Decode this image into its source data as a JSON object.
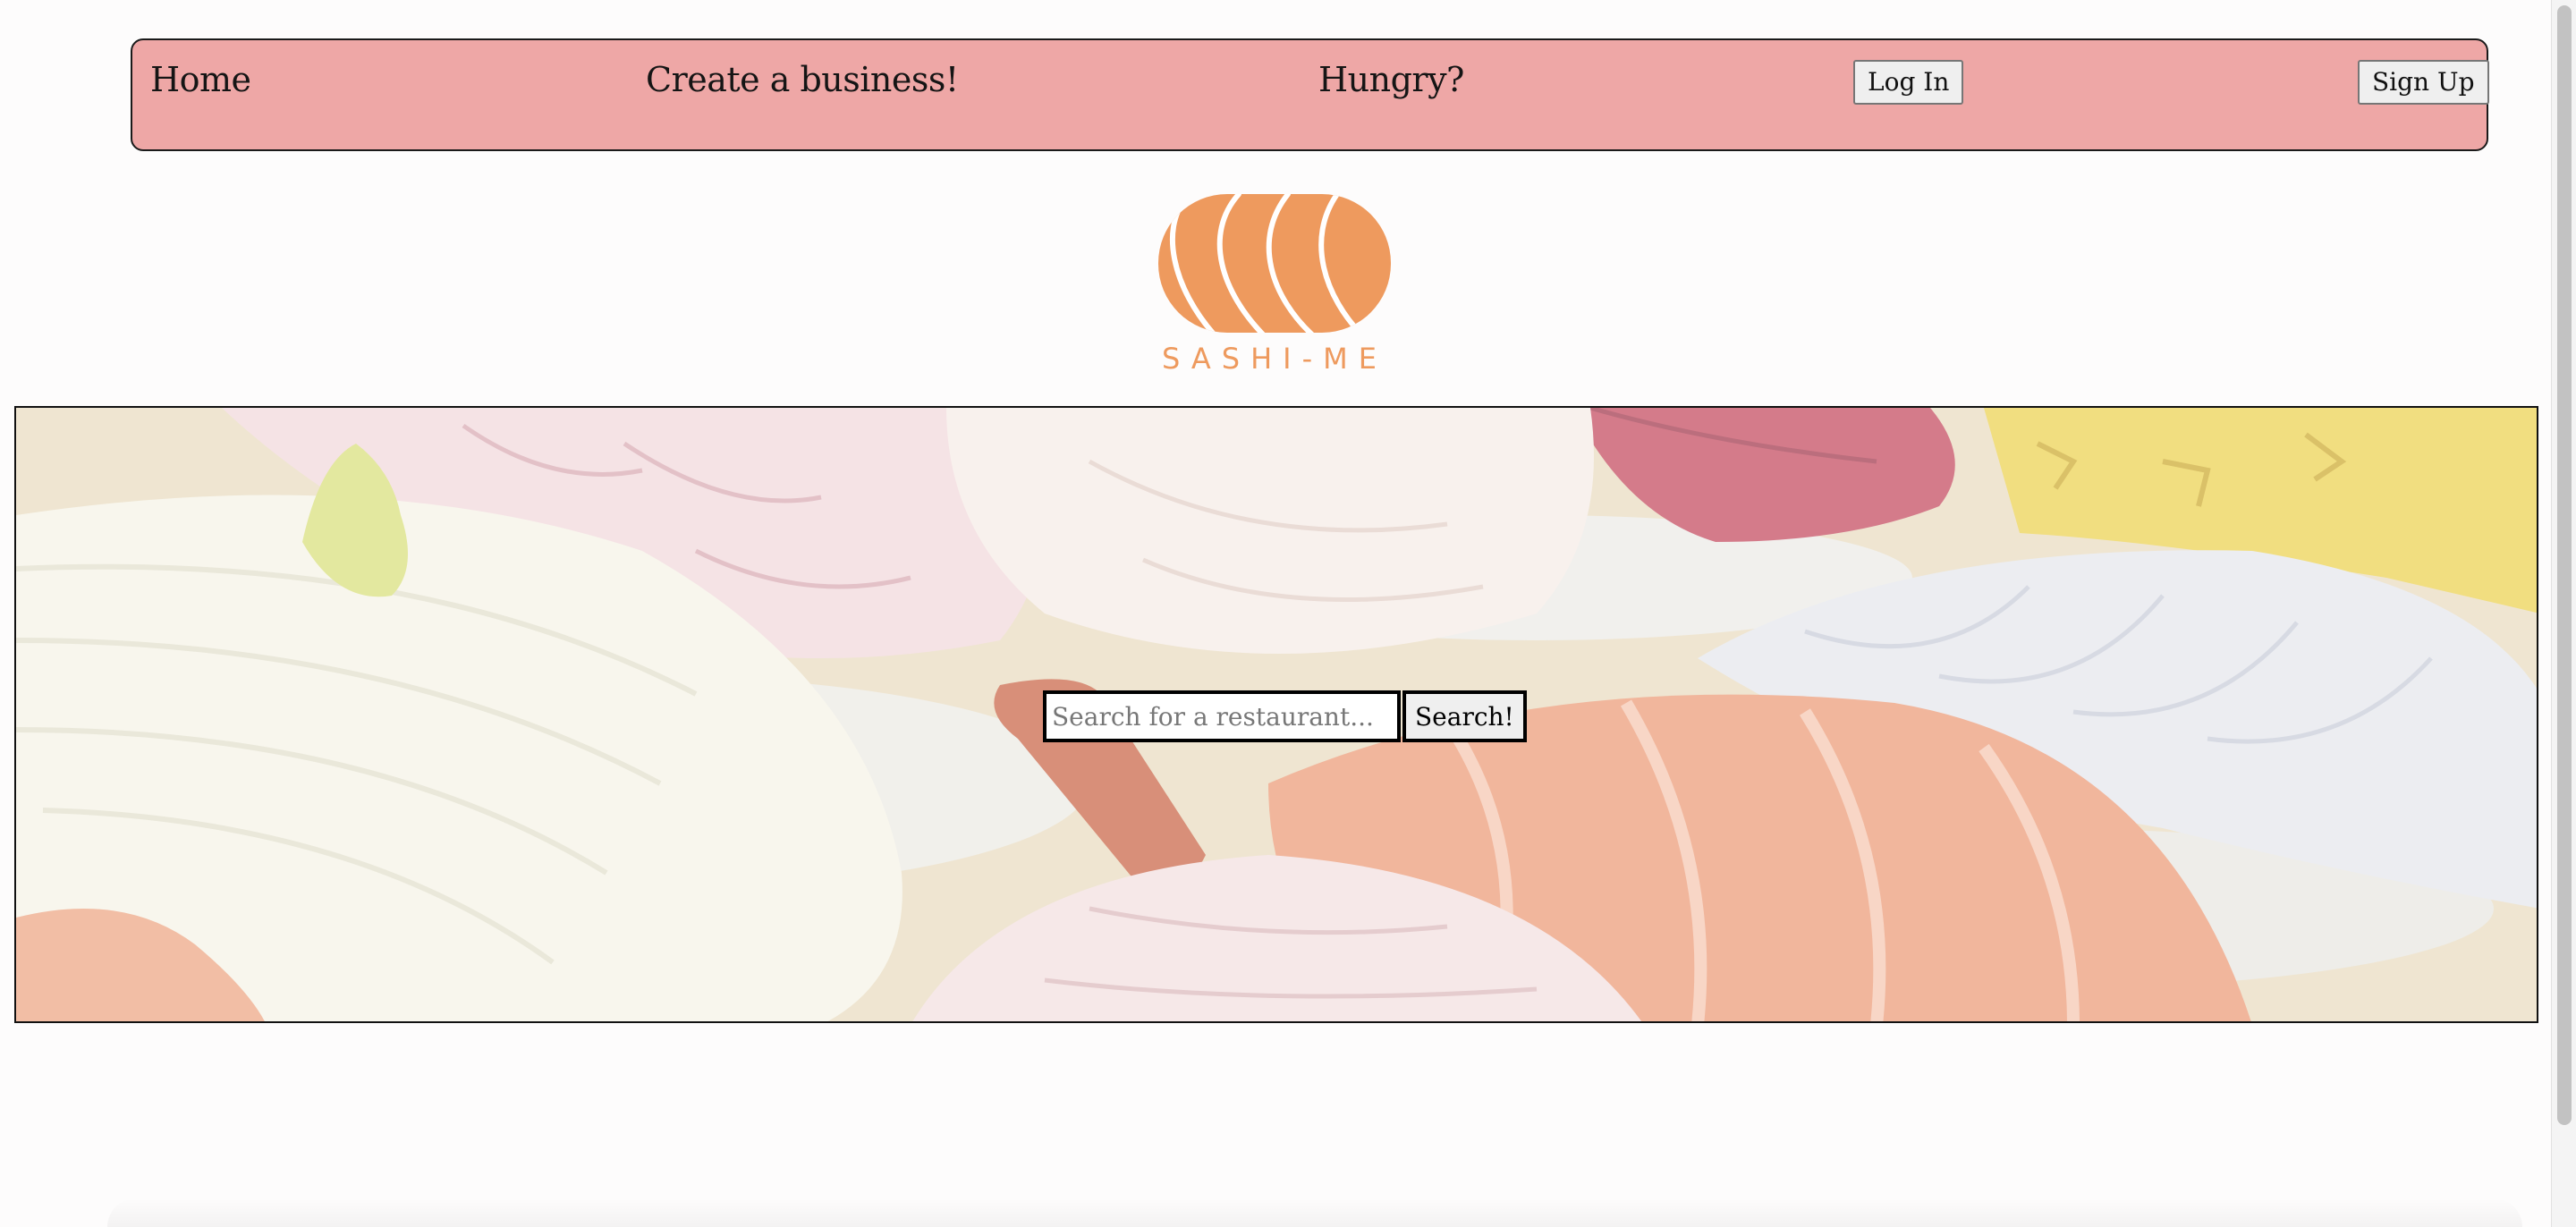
{
  "nav": {
    "home": "Home",
    "create_business": "Create a business!",
    "hungry": "Hungry?",
    "login": "Log In",
    "signup": "Sign Up"
  },
  "logo": {
    "text": "SASHI-ME",
    "icon": "salmon-sashimi-icon"
  },
  "search": {
    "placeholder": "Search for a restaurant...",
    "value": "",
    "button": "Search!"
  },
  "hero": {
    "image": "sushi-platter-illustration"
  },
  "colors": {
    "nav_bg": "#eea7a6",
    "logo_orange": "#ee9a5e",
    "page_bg": "#fdfcfc"
  }
}
